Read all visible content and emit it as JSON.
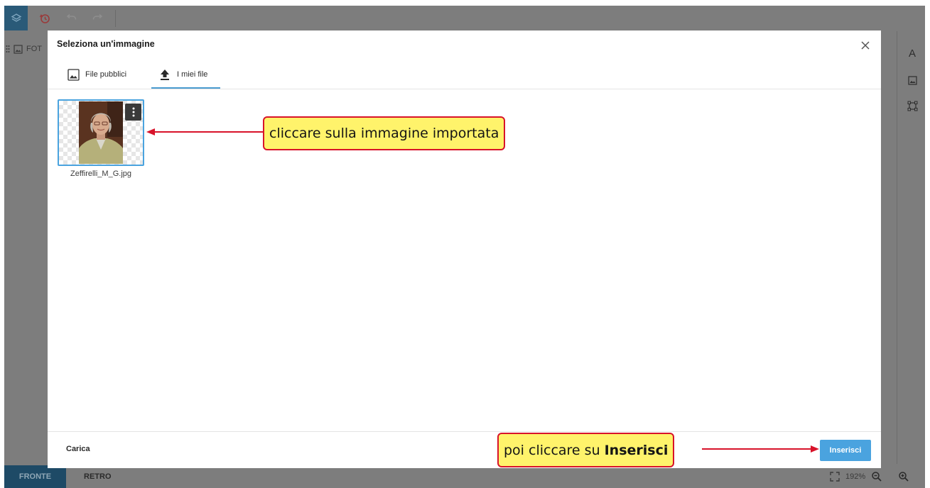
{
  "modal": {
    "title": "Seleziona un'immagine",
    "tabs": [
      {
        "label": "File pubblici",
        "icon": "image-icon"
      },
      {
        "label": "I miei file",
        "icon": "upload-icon",
        "active": true
      }
    ],
    "files": [
      {
        "name": "Zeffirelli_M_G.jpg",
        "selected": true
      }
    ],
    "footer": {
      "upload_label": "Carica",
      "insert_label": "Inserisci"
    }
  },
  "layer_panel": {
    "label": "FOT"
  },
  "bottombar": {
    "tabs": [
      "FRONTE",
      "RETRO"
    ],
    "zoom": "192%"
  },
  "annotations": {
    "callout1": "cliccare sulla immagine importata",
    "callout2_prefix": "poi cliccare su",
    "callout2_bold": "Inserisci"
  },
  "colors": {
    "accent": "#4aa3df",
    "callout_bg": "#fff36b",
    "callout_border": "#d8132a",
    "overlay": "#7d7d7d"
  }
}
